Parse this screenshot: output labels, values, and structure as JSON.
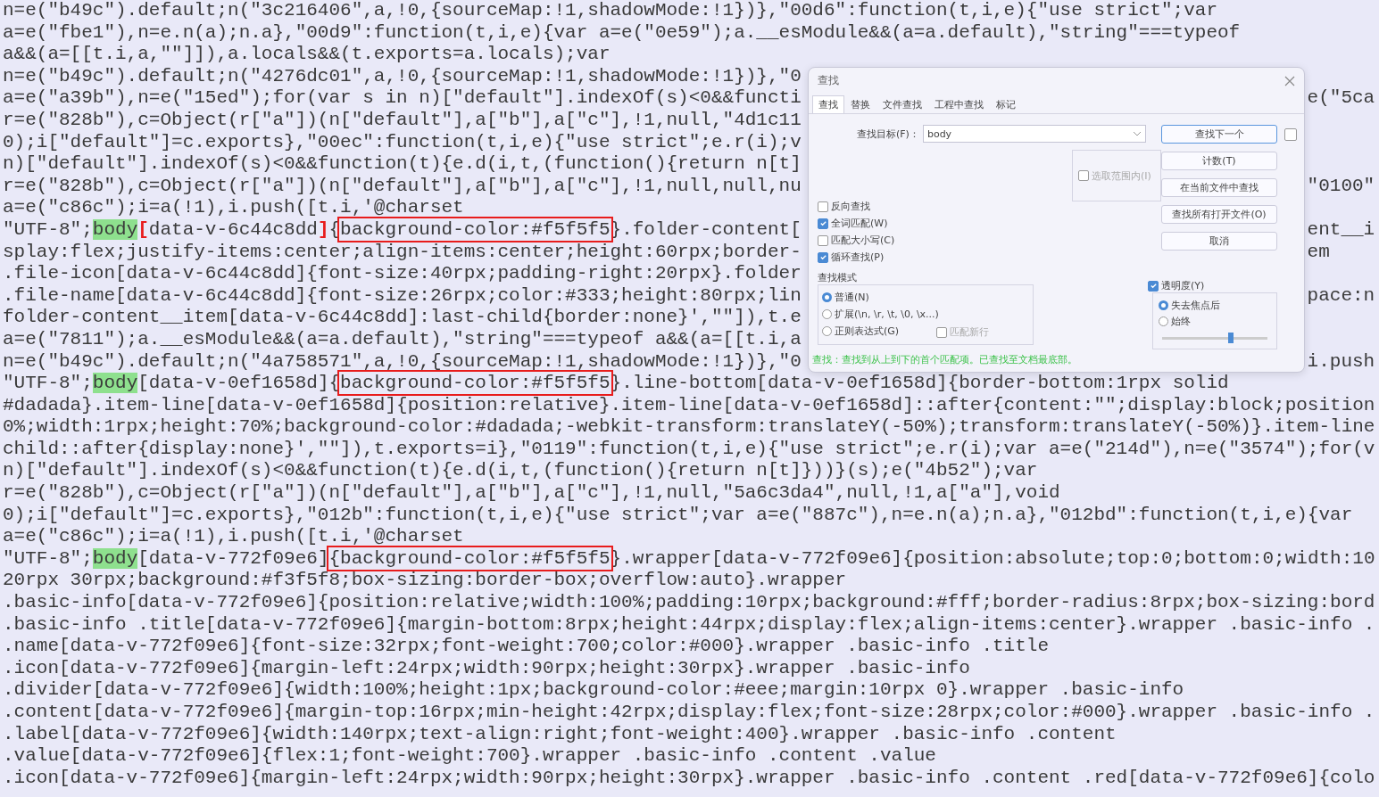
{
  "editor": {
    "lines": [
      {
        "segments": [
          {
            "kind": "text",
            "text": "n=e(\"b49c\").default;n(\"3c216406\",a,!0,{sourceMap:!1,shadowMode:!1})},\"00d6\":function(t,i,e){\"use strict\";var"
          }
        ]
      },
      {
        "segments": [
          {
            "kind": "text",
            "text": "a=e(\"fbe1\"),n=e.n(a);n.a},\"00d9\":function(t,i,e){var a=e(\"0e59\");a.__esModule&&(a=a.default),\"string\"===typeof"
          }
        ]
      },
      {
        "segments": [
          {
            "kind": "text",
            "text": "a&&(a=[[t.i,a,\"\"]]),a.locals&&(t.exports=a.locals);var"
          }
        ]
      },
      {
        "segments": [
          {
            "kind": "text",
            "text": "n=e(\"b49c\").default;n(\"4276dc01\",a,!0,{sourceMap:!1,shadowMode:!1})},\"0"
          }
        ]
      },
      {
        "segments": [
          {
            "kind": "text",
            "text": "a=e(\"a39b\"),n=e(\"15ed\");for(var s in n)[\"default\"].indexOf(s)<0&&functi"
          }
        ],
        "right_of_dialog": "e(\"5ca"
      },
      {
        "segments": [
          {
            "kind": "text",
            "text": "r=e(\"828b\"),c=Object(r[\"a\"])(n[\"default\"],a[\"b\"],a[\"c\"],!1,null,\"4d1c11"
          }
        ]
      },
      {
        "segments": [
          {
            "kind": "text",
            "text": "0);i[\"default\"]=c.exports},\"00ec\":function(t,i,e){\"use strict\";e.r(i);v"
          }
        ]
      },
      {
        "segments": [
          {
            "kind": "text",
            "text": "n)[\"default\"].indexOf(s)<0&&function(t){e.d(i,t,(function(){return n[t]"
          }
        ]
      },
      {
        "segments": [
          {
            "kind": "text",
            "text": "r=e(\"828b\"),c=Object(r[\"a\"])(n[\"default\"],a[\"b\"],a[\"c\"],!1,null,null,nu"
          }
        ],
        "right_of_dialog": "\"0100\""
      },
      {
        "segments": [
          {
            "kind": "text",
            "text": "a=e(\"c86c\");i=a(!1),i.push([t.i,'@charset"
          }
        ]
      },
      {
        "segments": [
          {
            "kind": "text",
            "text": "\"UTF-8\";"
          },
          {
            "kind": "match",
            "text": "body"
          },
          {
            "kind": "brace",
            "text": "["
          },
          {
            "kind": "text",
            "text": "data-v-6c44c8dd"
          },
          {
            "kind": "brace",
            "text": "]"
          },
          {
            "kind": "text",
            "text": "{"
          },
          {
            "kind": "boxed",
            "text": "background-color:#f5f5f5"
          },
          {
            "kind": "text",
            "text": "}.folder-content["
          }
        ],
        "right_of_dialog": "ent__i"
      },
      {
        "segments": [
          {
            "kind": "text",
            "text": "splay:flex;justify-items:center;align-items:center;height:60rpx;border-"
          }
        ],
        "right_of_dialog": "em"
      },
      {
        "segments": [
          {
            "kind": "text",
            "text": ".file-icon[data-v-6c44c8dd]{font-size:40rpx;padding-right:20rpx}.folder"
          }
        ]
      },
      {
        "segments": [
          {
            "kind": "text",
            "text": ".file-name[data-v-6c44c8dd]{font-size:26rpx;color:#333;height:80rpx;lin"
          }
        ],
        "right_of_dialog": "pace:n"
      },
      {
        "segments": [
          {
            "kind": "text",
            "text": "folder-content__item[data-v-6c44c8dd]:last-child{border:none}',\"\"]),t.e"
          }
        ]
      },
      {
        "segments": [
          {
            "kind": "text",
            "text": "a=e(\"7811\");a.__esModule&&(a=a.default),\"string\"===typeof a&&(a=[[t.i,a"
          }
        ]
      },
      {
        "segments": [
          {
            "kind": "text",
            "text": "n=e(\"b49c\").default;n(\"4a758571\",a,!0,{sourceMap:!1,shadowMode:!1})},\"0"
          }
        ],
        "right_of_dialog": "i.push"
      },
      {
        "segments": [
          {
            "kind": "text",
            "text": "\"UTF-8\";"
          },
          {
            "kind": "match",
            "text": "body"
          },
          {
            "kind": "text",
            "text": "[data-v-0ef1658d]{"
          },
          {
            "kind": "boxed",
            "text": "background-color:#f5f5f5"
          },
          {
            "kind": "text",
            "text": "}.line-bottom[data-v-0ef1658d]{border-bottom:1rpx solid"
          }
        ]
      },
      {
        "segments": [
          {
            "kind": "text",
            "text": "#dadada}.item-line[data-v-0ef1658d]{position:relative}.item-line[data-v-0ef1658d]::after{content:\"\";display:block;position"
          }
        ]
      },
      {
        "segments": [
          {
            "kind": "text",
            "text": "0%;width:1rpx;height:70%;background-color:#dadada;-webkit-transform:translateY(-50%);transform:translateY(-50%)}.item-line"
          }
        ]
      },
      {
        "segments": [
          {
            "kind": "text",
            "text": "child::after{display:none}',\"\"]),t.exports=i},\"0119\":function(t,i,e){\"use strict\";e.r(i);var a=e(\"214d\"),n=e(\"3574\");for(v"
          }
        ]
      },
      {
        "segments": [
          {
            "kind": "text",
            "text": "n)[\"default\"].indexOf(s)<0&&function(t){e.d(i,t,(function(){return n[t]}))}(s);e(\"4b52\");var"
          }
        ]
      },
      {
        "segments": [
          {
            "kind": "text",
            "text": "r=e(\"828b\"),c=Object(r[\"a\"])(n[\"default\"],a[\"b\"],a[\"c\"],!1,null,\"5a6c3da4\",null,!1,a[\"a\"],void"
          }
        ]
      },
      {
        "segments": [
          {
            "kind": "text",
            "text": "0);i[\"default\"]=c.exports},\"012b\":function(t,i,e){\"use strict\";var a=e(\"887c\"),n=e.n(a);n.a},\"012bd\":function(t,i,e){var"
          }
        ]
      },
      {
        "segments": [
          {
            "kind": "text",
            "text": "a=e(\"c86c\");i=a(!1),i.push([t.i,'@charset"
          }
        ]
      },
      {
        "segments": [
          {
            "kind": "text",
            "text": "\"UTF-8\";"
          },
          {
            "kind": "match",
            "text": "body"
          },
          {
            "kind": "text",
            "text": "[data-v-772f09e6]"
          },
          {
            "kind": "boxed",
            "text": "{background-color:#f5f5f5"
          },
          {
            "kind": "text",
            "text": "}.wrapper[data-v-772f09e6]{position:absolute;top:0;bottom:0;width:10"
          }
        ]
      },
      {
        "segments": [
          {
            "kind": "text",
            "text": "20rpx 30rpx;background:#f3f5f8;box-sizing:border-box;overflow:auto}.wrapper"
          }
        ]
      },
      {
        "segments": [
          {
            "kind": "text",
            "text": ".basic-info[data-v-772f09e6]{position:relative;width:100%;padding:10rpx;background:#fff;border-radius:8rpx;box-sizing:bord"
          }
        ]
      },
      {
        "segments": [
          {
            "kind": "text",
            "text": ".basic-info .title[data-v-772f09e6]{margin-bottom:8rpx;height:44rpx;display:flex;align-items:center}.wrapper .basic-info ."
          }
        ]
      },
      {
        "segments": [
          {
            "kind": "text",
            "text": ".name[data-v-772f09e6]{font-size:32rpx;font-weight:700;color:#000}.wrapper .basic-info .title"
          }
        ]
      },
      {
        "segments": [
          {
            "kind": "text",
            "text": ".icon[data-v-772f09e6]{margin-left:24rpx;width:90rpx;height:30rpx}.wrapper .basic-info"
          }
        ]
      },
      {
        "segments": [
          {
            "kind": "text",
            "text": ".divider[data-v-772f09e6]{width:100%;height:1px;background-color:#eee;margin:10rpx 0}.wrapper .basic-info"
          }
        ]
      },
      {
        "segments": [
          {
            "kind": "text",
            "text": ".content[data-v-772f09e6]{margin-top:16rpx;min-height:42rpx;display:flex;font-size:28rpx;color:#000}.wrapper .basic-info ."
          }
        ]
      },
      {
        "segments": [
          {
            "kind": "text",
            "text": ".label[data-v-772f09e6]{width:140rpx;text-align:right;font-weight:400}.wrapper .basic-info .content"
          }
        ]
      },
      {
        "segments": [
          {
            "kind": "text",
            "text": ".value[data-v-772f09e6]{flex:1;font-weight:700}.wrapper .basic-info .content .value"
          }
        ]
      },
      {
        "segments": [
          {
            "kind": "text",
            "text": ".icon[data-v-772f09e6]{margin-left:24rpx;width:90rpx;height:30rpx}.wrapper .basic-info .content .red[data-v-772f09e6]{colo"
          }
        ]
      }
    ]
  },
  "find_dialog": {
    "title": "查找",
    "tabs": [
      {
        "label": "查找",
        "selected": true
      },
      {
        "label": "替换",
        "selected": false
      },
      {
        "label": "文件查找",
        "selected": false
      },
      {
        "label": "工程中查找",
        "selected": false
      },
      {
        "label": "标记",
        "selected": false
      }
    ],
    "target_label": "查找目标(F)：",
    "target_value": "body",
    "buttons": [
      {
        "label": "查找下一个",
        "focused": true
      },
      {
        "label": "计数(T)",
        "focused": false
      },
      {
        "label": "在当前文件中查找",
        "focused": false
      },
      {
        "label": "查找所有打开文件(O)",
        "focused": false
      },
      {
        "label": "取消",
        "focused": false
      }
    ],
    "side_checkbox": {
      "checked": false
    },
    "scope": {
      "label": "选取范围内(I)",
      "checked": false,
      "disabled": true
    },
    "options": [
      {
        "label": "反向查找",
        "checked": false
      },
      {
        "label": "全词匹配(W)",
        "checked": true
      },
      {
        "label": "匹配大小写(C)",
        "checked": false
      },
      {
        "label": "循环查找(P)",
        "checked": true
      }
    ],
    "mode": {
      "title": "查找模式",
      "options": [
        {
          "label": "普通(N)",
          "selected": true
        },
        {
          "label": "扩展(\\n, \\r, \\t, \\0, \\x...)",
          "selected": false
        },
        {
          "label": "正则表达式(G)",
          "selected": false
        }
      ],
      "newline": {
        "label": "匹配新行",
        "checked": false,
        "disabled": true
      }
    },
    "transparency": {
      "label": "透明度(Y)",
      "checked": true,
      "options": [
        {
          "label": "失去焦点后",
          "selected": true
        },
        {
          "label": "始终",
          "selected": false
        }
      ],
      "level": 0.65
    },
    "status": "查找：查找到从上到下的首个匹配项。已查找至文档最底部。"
  }
}
